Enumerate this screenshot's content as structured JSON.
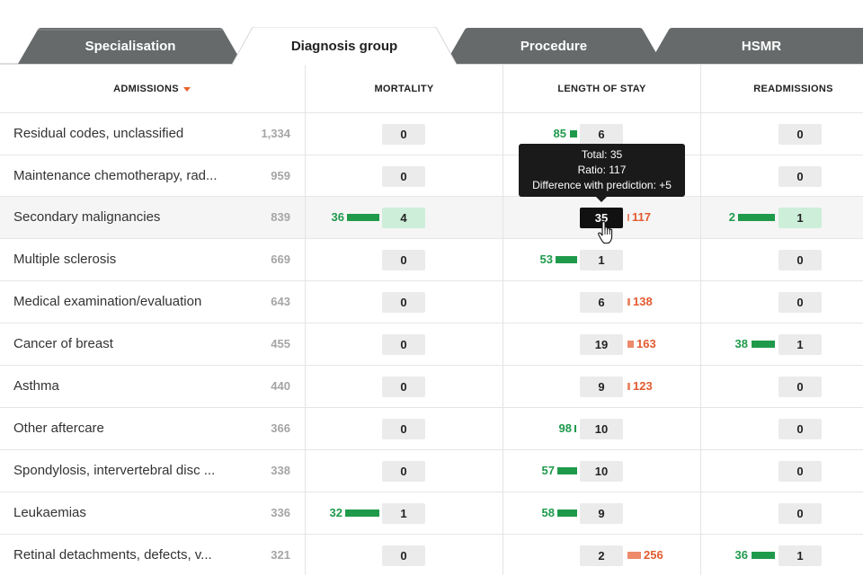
{
  "tabs": [
    {
      "label": "Specialisation",
      "active": false
    },
    {
      "label": "Diagnosis group",
      "active": true
    },
    {
      "label": "Procedure",
      "active": false
    },
    {
      "label": "HSMR",
      "active": false
    }
  ],
  "columns": {
    "admissions": "ADMISSIONS",
    "mortality": "MORTALITY",
    "length_of_stay": "LENGTH OF STAY",
    "readmissions": "READMISSIONS"
  },
  "rows": [
    {
      "name": "Residual codes, unclassified",
      "count": "1,334",
      "mortality": {
        "value": "0"
      },
      "los": {
        "value": "6",
        "left_num": "85"
      },
      "readmissions": {
        "value": "0"
      }
    },
    {
      "name": "Maintenance chemotherapy, rad...",
      "count": "959",
      "mortality": {
        "value": "0"
      },
      "los": {
        "value": ""
      },
      "readmissions": {
        "value": "0"
      }
    },
    {
      "name": "Secondary malignancies",
      "count": "839",
      "mortality": {
        "value": "4",
        "left_num": "36"
      },
      "los": {
        "value": "35",
        "right_num": "117"
      },
      "readmissions": {
        "value": "1",
        "left_num": "2"
      }
    },
    {
      "name": "Multiple sclerosis",
      "count": "669",
      "mortality": {
        "value": "0"
      },
      "los": {
        "value": "1",
        "left_num": "53"
      },
      "readmissions": {
        "value": "0"
      }
    },
    {
      "name": "Medical examination/evaluation",
      "count": "643",
      "mortality": {
        "value": "0"
      },
      "los": {
        "value": "6",
        "right_num": "138"
      },
      "readmissions": {
        "value": "0"
      }
    },
    {
      "name": "Cancer of breast",
      "count": "455",
      "mortality": {
        "value": "0"
      },
      "los": {
        "value": "19",
        "right_num": "163"
      },
      "readmissions": {
        "value": "1",
        "left_num": "38"
      }
    },
    {
      "name": "Asthma",
      "count": "440",
      "mortality": {
        "value": "0"
      },
      "los": {
        "value": "9",
        "right_num": "123"
      },
      "readmissions": {
        "value": "0"
      }
    },
    {
      "name": "Other aftercare",
      "count": "366",
      "mortality": {
        "value": "0"
      },
      "los": {
        "value": "10",
        "left_num": "98"
      },
      "readmissions": {
        "value": "0"
      }
    },
    {
      "name": "Spondylosis, intervertebral disc ...",
      "count": "338",
      "mortality": {
        "value": "0"
      },
      "los": {
        "value": "10",
        "left_num": "57"
      },
      "readmissions": {
        "value": "0"
      }
    },
    {
      "name": "Leukaemias",
      "count": "336",
      "mortality": {
        "value": "1",
        "left_num": "32"
      },
      "los": {
        "value": "9",
        "left_num": "58"
      },
      "readmissions": {
        "value": "0"
      }
    },
    {
      "name": "Retinal detachments, defects, v...",
      "count": "321",
      "mortality": {
        "value": "0"
      },
      "los": {
        "value": "2",
        "right_num": "256"
      },
      "readmissions": {
        "value": "1",
        "left_num": "36"
      }
    }
  ],
  "tooltip": {
    "line1": "Total: 35",
    "line2": "Ratio: 117",
    "line3": "Difference with prediction: +5"
  },
  "colors": {
    "green": "#1f9a4b",
    "red": "#e35a2f",
    "tab_inactive": "#6b6f70"
  },
  "icons": {
    "cursor": "hand-pointer-icon",
    "sort": "sort-down-icon"
  }
}
